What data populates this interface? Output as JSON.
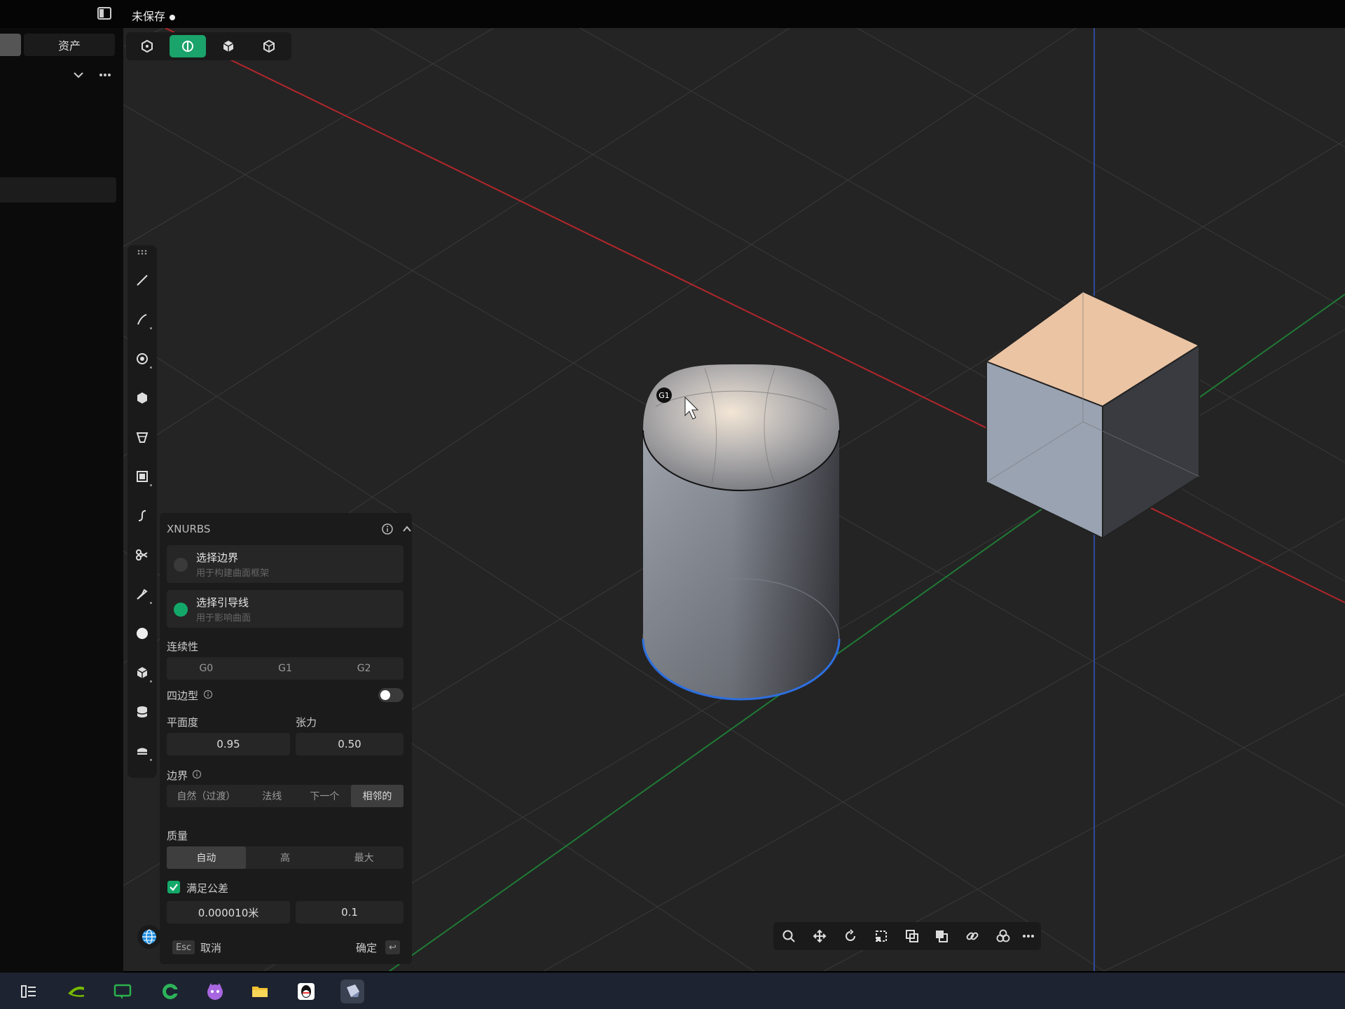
{
  "topbar": {
    "title": "未保存"
  },
  "sidebar": {
    "tab_assets": "资产"
  },
  "view_toolbar": {
    "active_index": 1
  },
  "scene": {
    "marker": "G1"
  },
  "xnurbs": {
    "title": "XNURBS",
    "select_boundary": {
      "label": "选择边界",
      "hint": "用于构建曲面框架"
    },
    "select_guide": {
      "label": "选择引导线",
      "hint": "用于影响曲面"
    },
    "continuity": {
      "label": "连续性",
      "options": [
        "G0",
        "G1",
        "G2"
      ]
    },
    "quad": {
      "label": "四边型",
      "enabled": false
    },
    "flatness": {
      "label": "平面度",
      "value": "0.95"
    },
    "tension": {
      "label": "张力",
      "value": "0.50"
    },
    "boundary": {
      "label": "边界",
      "options": [
        "自然（过渡）",
        "法线",
        "下一个",
        "相邻的"
      ],
      "selected": 3
    },
    "quality": {
      "label": "质量",
      "options": [
        "自动",
        "高",
        "最大"
      ],
      "selected": 0
    },
    "tolerance": {
      "label": "满足公差",
      "checked": true,
      "value": "0.000010米",
      "angle": "0.1"
    },
    "footer": {
      "esc_key": "Esc",
      "cancel": "取消",
      "confirm": "确定",
      "enter_key": "↩"
    }
  },
  "colors": {
    "accent": "#1aa36a",
    "viewport_bg": "#242424",
    "axis_x": "#b3262b",
    "axis_y": "#1f7a35",
    "axis_z": "#2f4a9a",
    "selection_edge": "#2d6fe0"
  },
  "icons": {
    "view_toolbar": [
      "hexagon-outline-icon",
      "shaded-view-icon",
      "cube-solid-icon",
      "cube-wire-icon"
    ],
    "tools": [
      "line-icon",
      "arc-icon",
      "circle-icon",
      "hexagon-icon",
      "cone-icon",
      "rectangle-icon",
      "curve-icon",
      "scissors-icon",
      "knife-icon",
      "sphere-icon",
      "box-icon",
      "cylinder-icon",
      "extrude-icon"
    ],
    "bottom_toolbar": [
      "search-icon",
      "move-icon",
      "rotate-icon",
      "scale-icon",
      "copy-icon",
      "boolean-icon",
      "link-icon",
      "group-icon",
      "more-icon"
    ],
    "taskbar": [
      "taskview-icon",
      "nvidia-icon",
      "chat-icon",
      "browser-icon",
      "cat-icon",
      "folder-icon",
      "qq-icon",
      "cad-icon"
    ]
  }
}
